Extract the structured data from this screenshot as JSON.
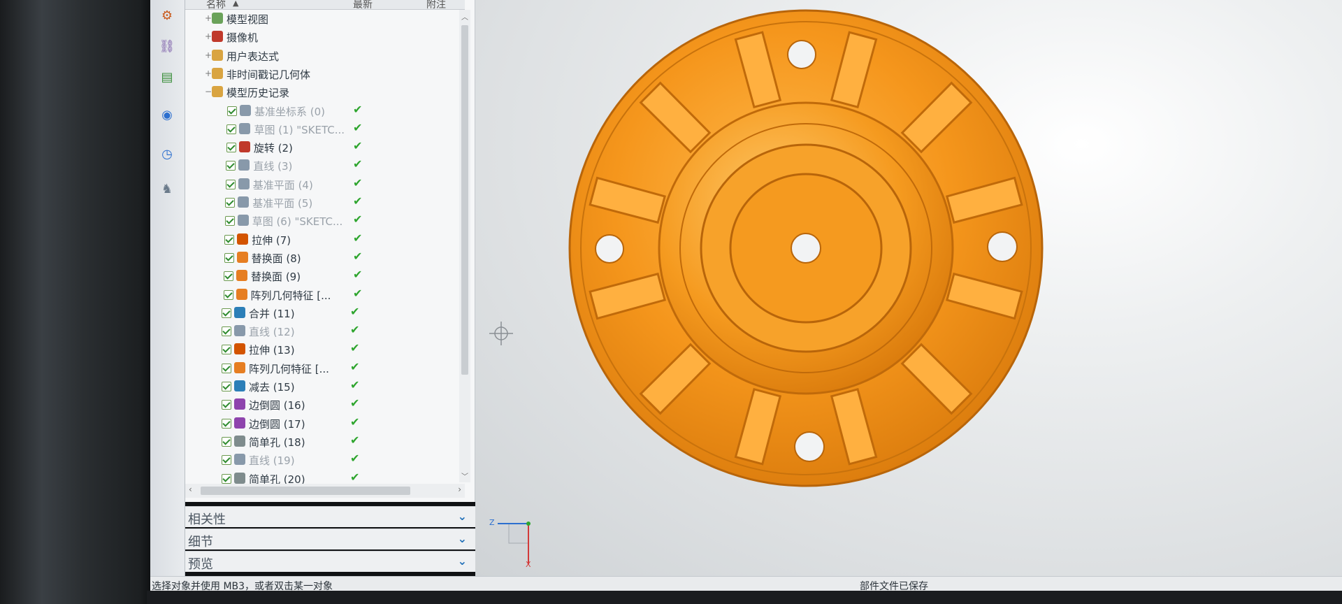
{
  "nav_header": {
    "name_col": "名称",
    "latest_col": "最新",
    "note_col": "附注"
  },
  "tree": [
    {
      "label": "模型视图",
      "indent": 0,
      "expander": "+",
      "muted": false,
      "check": false,
      "status": "",
      "icon": "model-view-icon",
      "icon_color": "#6aa25a"
    },
    {
      "label": "摄像机",
      "indent": 0,
      "expander": "+",
      "muted": false,
      "check": false,
      "status": "",
      "icon": "camera-icon",
      "icon_color": "#c0392b"
    },
    {
      "label": "用户表达式",
      "indent": 0,
      "expander": "+",
      "muted": false,
      "check": false,
      "status": "",
      "icon": "folder-icon",
      "icon_color": "#d9a441"
    },
    {
      "label": "非时间戳记几何体",
      "indent": 0,
      "expander": "+",
      "muted": false,
      "check": false,
      "status": "",
      "icon": "folder-icon",
      "icon_color": "#d9a441"
    },
    {
      "label": "模型历史记录",
      "indent": 0,
      "expander": "-",
      "muted": false,
      "check": false,
      "status": "",
      "icon": "folder-open-icon",
      "icon_color": "#d9a441"
    },
    {
      "label": "基准坐标系 (0)",
      "indent": 1,
      "muted": true,
      "check": true,
      "status": "✔",
      "icon": "datum-csys-icon",
      "icon_color": "#8899aa"
    },
    {
      "label": "草图 (1) \"SKETC...",
      "indent": 1,
      "muted": true,
      "check": true,
      "status": "✔",
      "icon": "sketch-icon",
      "icon_color": "#8899aa"
    },
    {
      "label": "旋转 (2)",
      "indent": 1,
      "muted": false,
      "check": true,
      "status": "✔",
      "icon": "revolve-icon",
      "icon_color": "#c0392b"
    },
    {
      "label": "直线 (3)",
      "indent": 1,
      "muted": true,
      "check": true,
      "status": "✔",
      "icon": "line-icon",
      "icon_color": "#8899aa"
    },
    {
      "label": "基准平面 (4)",
      "indent": 1,
      "muted": true,
      "check": true,
      "status": "✔",
      "icon": "datum-plane-icon",
      "icon_color": "#8899aa"
    },
    {
      "label": "基准平面 (5)",
      "indent": 1,
      "muted": true,
      "check": true,
      "status": "✔",
      "icon": "datum-plane-icon",
      "icon_color": "#8899aa"
    },
    {
      "label": "草图 (6) \"SKETC...",
      "indent": 1,
      "muted": true,
      "check": true,
      "status": "✔",
      "icon": "sketch-icon",
      "icon_color": "#8899aa"
    },
    {
      "label": "拉伸 (7)",
      "indent": 1,
      "muted": false,
      "check": true,
      "status": "✔",
      "icon": "extrude-icon",
      "icon_color": "#d35400"
    },
    {
      "label": "替换面 (8)",
      "indent": 1,
      "muted": false,
      "check": true,
      "status": "✔",
      "icon": "replace-face-icon",
      "icon_color": "#e67e22"
    },
    {
      "label": "替换面 (9)",
      "indent": 1,
      "muted": false,
      "check": true,
      "status": "✔",
      "icon": "replace-face-icon",
      "icon_color": "#e67e22"
    },
    {
      "label": "阵列几何特征 [...",
      "indent": 1,
      "muted": false,
      "check": true,
      "status": "✔",
      "icon": "pattern-icon",
      "icon_color": "#e67e22"
    },
    {
      "label": "合并 (11)",
      "indent": 1,
      "muted": false,
      "check": true,
      "status": "✔",
      "icon": "unite-icon",
      "icon_color": "#2c7fb8"
    },
    {
      "label": "直线 (12)",
      "indent": 1,
      "muted": true,
      "check": true,
      "status": "✔",
      "icon": "line-icon",
      "icon_color": "#8899aa"
    },
    {
      "label": "拉伸 (13)",
      "indent": 1,
      "muted": false,
      "check": true,
      "status": "✔",
      "icon": "extrude-icon",
      "icon_color": "#d35400"
    },
    {
      "label": "阵列几何特征 [...",
      "indent": 1,
      "muted": false,
      "check": true,
      "status": "✔",
      "icon": "pattern-icon",
      "icon_color": "#e67e22"
    },
    {
      "label": "减去 (15)",
      "indent": 1,
      "muted": false,
      "check": true,
      "status": "✔",
      "icon": "subtract-icon",
      "icon_color": "#2c7fb8"
    },
    {
      "label": "边倒圆 (16)",
      "indent": 1,
      "muted": false,
      "check": true,
      "status": "✔",
      "icon": "edge-blend-icon",
      "icon_color": "#8e44ad"
    },
    {
      "label": "边倒圆 (17)",
      "indent": 1,
      "muted": false,
      "check": true,
      "status": "✔",
      "icon": "edge-blend-icon",
      "icon_color": "#8e44ad"
    },
    {
      "label": "简单孔 (18)",
      "indent": 1,
      "muted": false,
      "check": true,
      "status": "✔",
      "icon": "hole-icon",
      "icon_color": "#7f8c8d"
    },
    {
      "label": "直线 (19)",
      "indent": 1,
      "muted": true,
      "check": true,
      "status": "✔",
      "icon": "line-icon",
      "icon_color": "#8899aa"
    },
    {
      "label": "简单孔 (20)",
      "indent": 1,
      "muted": false,
      "check": true,
      "status": "✔",
      "icon": "hole-icon",
      "icon_color": "#7f8c8d"
    }
  ],
  "sections": [
    {
      "label": "相关性",
      "chevron": "⌄"
    },
    {
      "label": "细节",
      "chevron": "⌄"
    },
    {
      "label": "预览",
      "chevron": "⌄"
    }
  ],
  "left_toolbar": [
    {
      "name": "part-navigator-icon",
      "glyph": "⚙"
    },
    {
      "name": "assembly-navigator-icon",
      "glyph": "⛓"
    },
    {
      "name": "reuse-library-icon",
      "glyph": "▤"
    },
    {
      "name": "web-browser-icon",
      "glyph": "◉"
    },
    {
      "name": "history-icon",
      "glyph": "◷"
    },
    {
      "name": "roles-icon",
      "glyph": "♞"
    }
  ],
  "status": {
    "prompt": "选择对象并使用 MB3，或者双击某一对象",
    "message": "部件文件已保存"
  },
  "triad": {
    "z_label": "Z",
    "x_label": "X"
  },
  "colors": {
    "part": "#f39c1f",
    "status_ok": "#2ea52e",
    "accent": "#1f6fb8"
  }
}
